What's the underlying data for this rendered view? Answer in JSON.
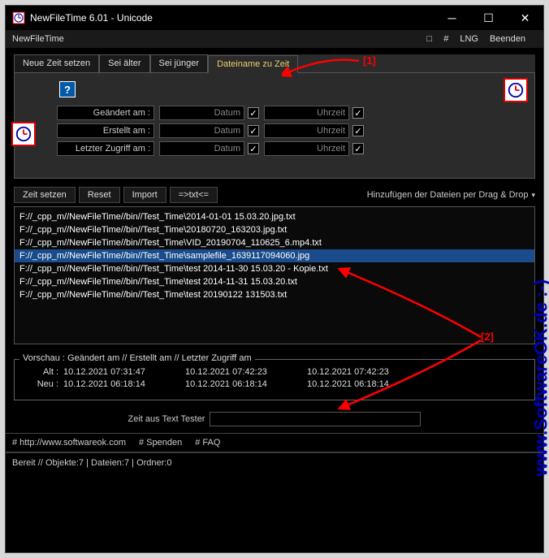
{
  "title": "NewFileTime 6.01 - Unicode",
  "menu": {
    "app": "NewFileTime",
    "box": "□",
    "hash": "#",
    "lng": "LNG",
    "exit": "Beenden"
  },
  "tabs": [
    "Neue Zeit setzen",
    "Sei älter",
    "Sei jünger",
    "Dateiname zu Zeit"
  ],
  "form": {
    "geaendert": "Geändert am :",
    "erstellt": "Erstellt am :",
    "zugriff": "Letzter Zugriff am :",
    "datum": "Datum",
    "uhrzeit": "Uhrzeit"
  },
  "buttons": {
    "set": "Zeit setzen",
    "reset": "Reset",
    "import": "Import",
    "txt": "=>txt<="
  },
  "drophint": "Hinzufügen der Dateien per Drag & Drop",
  "files": [
    "F://_cpp_m//NewFileTime//bin//Test_Time\\2014-01-01 15.03.20.jpg.txt",
    "F://_cpp_m//NewFileTime//bin//Test_Time\\20180720_163203.jpg.txt",
    "F://_cpp_m//NewFileTime//bin//Test_Time\\VID_20190704_110625_6.mp4.txt",
    "F://_cpp_m//NewFileTime//bin//Test_Time\\samplefile_1639117094060.jpg",
    "F://_cpp_m//NewFileTime//bin//Test_Time\\test 2014-11-30 15.03.20 - Kopie.txt",
    "F://_cpp_m//NewFileTime//bin//Test_Time\\test 2014-11-31 15.03.20.txt",
    "F://_cpp_m//NewFileTime//bin//Test_Time\\test 20190122 131503.txt"
  ],
  "preview": {
    "header": "Vorschau :   Geändert am    //    Erstellt am    //    Letzter Zugriff am",
    "alt_label": "Alt :",
    "neu_label": "Neu :",
    "alt": [
      "10.12.2021 07:31:47",
      "10.12.2021 07:42:23",
      "10.12.2021 07:42:23"
    ],
    "neu": [
      "10.12.2021 06:18:14",
      "10.12.2021 06:18:14",
      "10.12.2021 06:18:14"
    ]
  },
  "tester_label": "Zeit aus Text Tester",
  "footer": {
    "url": "# http://www.softwareok.com",
    "spenden": "# Spenden",
    "faq": "# FAQ"
  },
  "status": "Bereit // Objekte:7 | Dateien:7 | Ordner:0",
  "watermark": "www.SoftwareOK.de :-)",
  "annot": {
    "a1": "[1]",
    "a2": "[2]"
  }
}
